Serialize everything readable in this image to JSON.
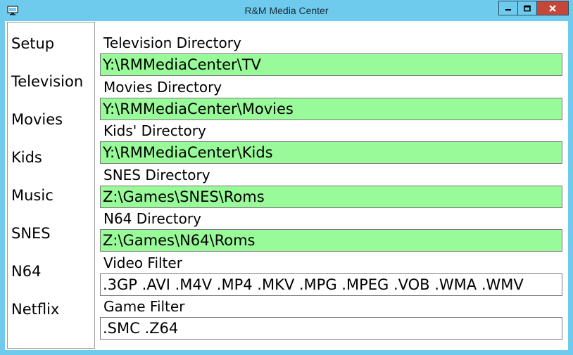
{
  "window": {
    "title": "R&M Media Center"
  },
  "sidebar": {
    "items": [
      {
        "label": "Setup"
      },
      {
        "label": "Television"
      },
      {
        "label": "Movies"
      },
      {
        "label": "Kids"
      },
      {
        "label": "Music"
      },
      {
        "label": "SNES"
      },
      {
        "label": "N64"
      },
      {
        "label": "Netflix"
      }
    ]
  },
  "settings": {
    "tv": {
      "label": "Television Directory",
      "value": "Y:\\RMMediaCenter\\TV"
    },
    "movies": {
      "label": "Movies Directory",
      "value": "Y:\\RMMediaCenter\\Movies"
    },
    "kids": {
      "label": "Kids' Directory",
      "value": "Y:\\RMMediaCenter\\Kids"
    },
    "snes": {
      "label": "SNES Directory",
      "value": "Z:\\Games\\SNES\\Roms"
    },
    "n64": {
      "label": "N64 Directory",
      "value": "Z:\\Games\\N64\\Roms"
    },
    "video_filter": {
      "label": "Video Filter",
      "value": ".3GP .AVI .M4V .MP4 .MKV .MPG .MPEG .VOB .WMA .WMV"
    },
    "game_filter": {
      "label": "Game Filter",
      "value": ".SMC .Z64"
    }
  },
  "colors": {
    "titlebar": "#6ecbee",
    "directory_field": "#99fa99",
    "close_button": "#c7463a"
  }
}
